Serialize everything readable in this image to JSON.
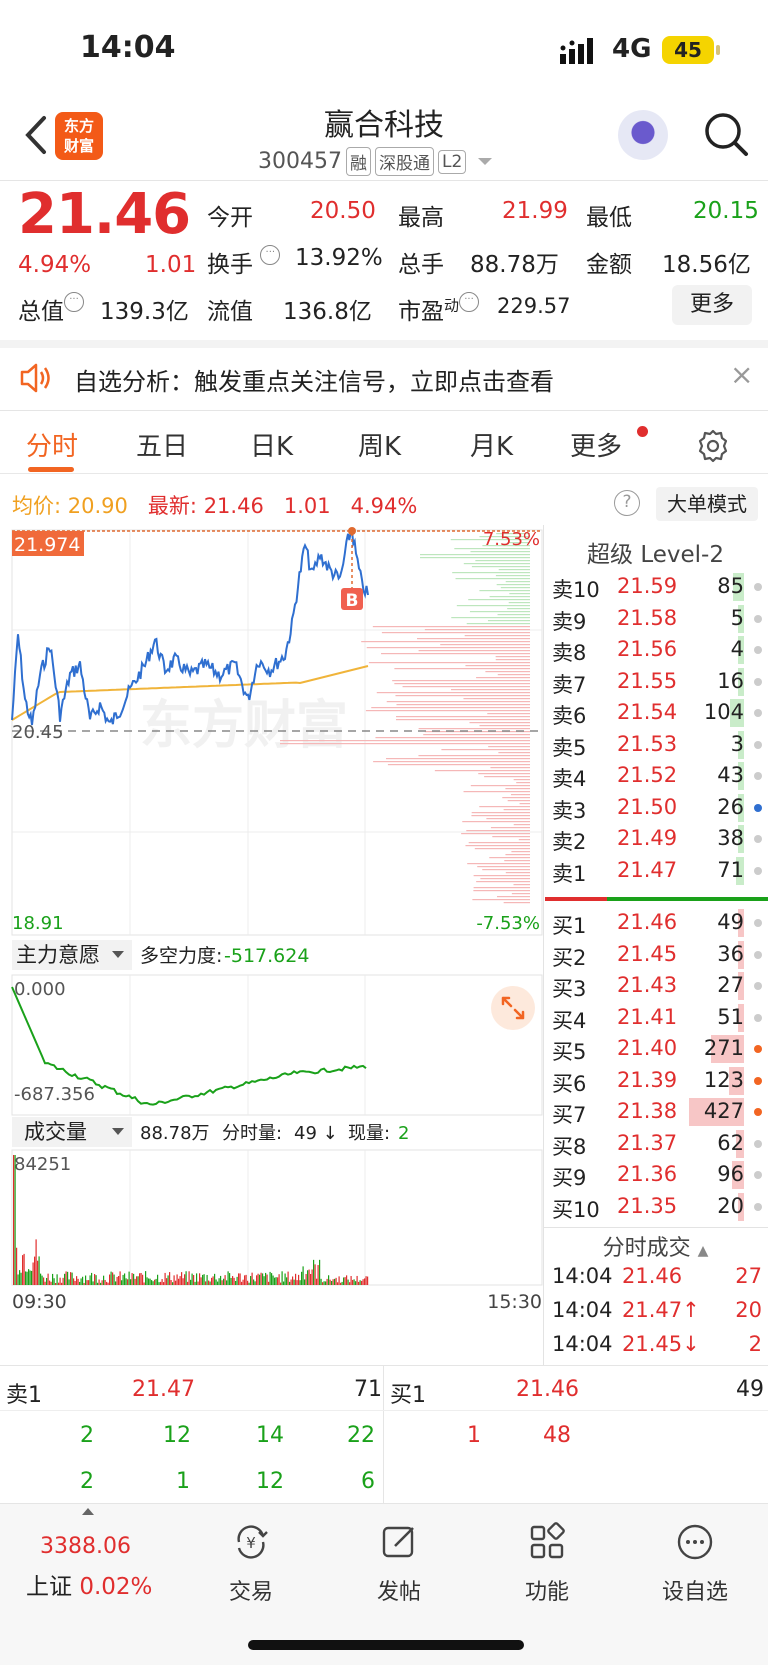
{
  "status_bar": {
    "time": "14:04",
    "network": "4G",
    "battery": "45"
  },
  "header": {
    "logo_line1": "东方",
    "logo_line2": "财富",
    "title": "赢合科技",
    "code": "300457",
    "tags": [
      "融",
      "深股通",
      "L2"
    ]
  },
  "quote": {
    "price": "21.46",
    "change_pct": "4.94%",
    "change": "1.01",
    "open_label": "今开",
    "open": "20.50",
    "high_label": "最高",
    "high": "21.99",
    "low_label": "最低",
    "low": "20.15",
    "turnover_label": "换手",
    "turnover": "13.92%",
    "volume_label": "总手",
    "volume": "88.78万",
    "amount_label": "金额",
    "amount": "18.56亿",
    "mktcap_label": "总值",
    "mktcap": "139.3亿",
    "float_label": "流值",
    "float": "136.8亿",
    "pe_label": "市盈",
    "pe_sup": "动",
    "pe": "229.57",
    "more_label": "更多"
  },
  "banner": {
    "text": "自选分析：触发重点关注信号，立即点击查看"
  },
  "tabs": [
    "分时",
    "五日",
    "日K",
    "周K",
    "月K",
    "更多"
  ],
  "avg_row": {
    "avg_label": "均价:",
    "avg": "20.90",
    "last_label": "最新:",
    "last": "21.46",
    "change": "1.01",
    "pct": "4.94%",
    "help": "?",
    "big_mode": "大单模式"
  },
  "price_chart": {
    "high_label": "21.974",
    "pre_close_label": "20.45",
    "low_label": "18.91",
    "up_pct": "7.53%",
    "down_pct": "-7.53%",
    "marker": "B",
    "watermark": "东方财富",
    "x_start": "09:30",
    "x_end": "15:30"
  },
  "indicator": {
    "name": "主力意愿",
    "extra_label": "多空力度:",
    "extra_value": "-517.624",
    "top_label": "0.000",
    "bottom_label": "-687.356"
  },
  "volume": {
    "name": "成交量",
    "total": "88.78万",
    "minute_label": "分时量:",
    "minute_value": "49 ↓",
    "now_label": "现量:",
    "now_value": "2",
    "max_label": "84251"
  },
  "level2": {
    "title": "超级 Level-2",
    "asks": [
      {
        "label": "卖10",
        "price": "21.59",
        "qty": "85",
        "bar": 0.2
      },
      {
        "label": "卖9",
        "price": "21.58",
        "qty": "5",
        "bar": 0.05
      },
      {
        "label": "卖8",
        "price": "21.56",
        "qty": "4",
        "bar": 0.05
      },
      {
        "label": "卖7",
        "price": "21.55",
        "qty": "16",
        "bar": 0.05
      },
      {
        "label": "卖6",
        "price": "21.54",
        "qty": "104",
        "bar": 0.25
      },
      {
        "label": "卖5",
        "price": "21.53",
        "qty": "3",
        "bar": 0.05
      },
      {
        "label": "卖4",
        "price": "21.52",
        "qty": "43",
        "bar": 0.1
      },
      {
        "label": "卖3",
        "price": "21.50",
        "qty": "26",
        "bar": 0.05
      },
      {
        "label": "卖2",
        "price": "21.49",
        "qty": "38",
        "bar": 0.1
      },
      {
        "label": "卖1",
        "price": "21.47",
        "qty": "71",
        "bar": 0.15
      }
    ],
    "bids": [
      {
        "label": "买1",
        "price": "21.46",
        "qty": "49",
        "bar": 0.1
      },
      {
        "label": "买2",
        "price": "21.45",
        "qty": "36",
        "bar": 0.08
      },
      {
        "label": "买3",
        "price": "21.43",
        "qty": "27",
        "bar": 0.06
      },
      {
        "label": "买4",
        "price": "21.41",
        "qty": "51",
        "bar": 0.1
      },
      {
        "label": "买5",
        "price": "21.40",
        "qty": "271",
        "bar": 0.6
      },
      {
        "label": "买6",
        "price": "21.39",
        "qty": "123",
        "bar": 0.28
      },
      {
        "label": "买7",
        "price": "21.38",
        "qty": "427",
        "bar": 1.0
      },
      {
        "label": "买8",
        "price": "21.37",
        "qty": "62",
        "bar": 0.14
      },
      {
        "label": "买9",
        "price": "21.36",
        "qty": "96",
        "bar": 0.22
      },
      {
        "label": "买10",
        "price": "21.35",
        "qty": "20",
        "bar": 0.05
      }
    ],
    "trades_title": "分时成交",
    "trades": [
      {
        "time": "14:04",
        "price": "21.46",
        "qty": "27"
      },
      {
        "time": "14:04",
        "price": "21.47↑",
        "qty": "20"
      },
      {
        "time": "14:04",
        "price": "21.45↓",
        "qty": "2"
      }
    ]
  },
  "queue": {
    "sell_label": "卖1",
    "sell_price": "21.47",
    "sell_total": "71",
    "buy_label": "买1",
    "buy_price": "21.46",
    "buy_total": "49",
    "sell_row1": [
      "2",
      "12",
      "14",
      "22"
    ],
    "sell_row2": [
      "2",
      "1",
      "12",
      "6"
    ],
    "buy_row1": [
      "1",
      "48"
    ]
  },
  "bottom_nav": {
    "index_value": "3388.06",
    "index_name": "上证",
    "index_pct": "0.02%",
    "items": [
      "交易",
      "发帖",
      "功能",
      "设自选"
    ]
  },
  "colors": {
    "up": "#e02e2e",
    "down": "#1aa11a",
    "accent": "#f26522",
    "price_line": "#2f6fd0",
    "avg_line": "#f0b43a"
  }
}
